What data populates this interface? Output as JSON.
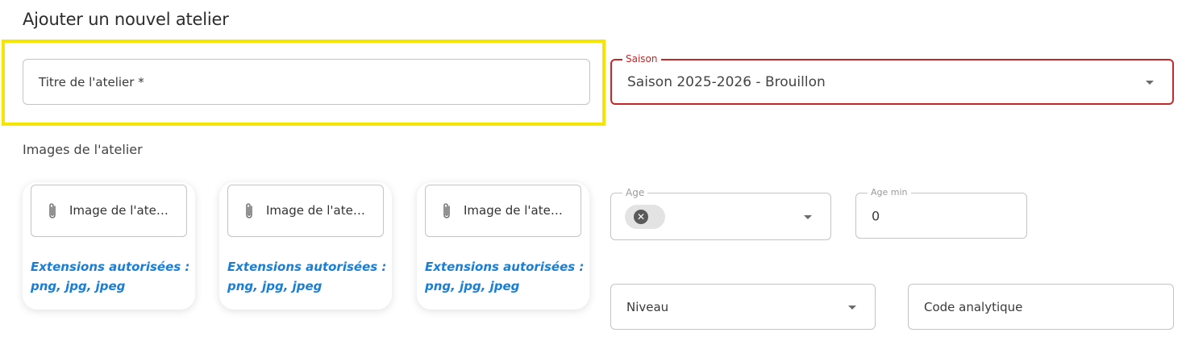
{
  "form": {
    "title": "Ajouter un nouvel atelier",
    "title_field": {
      "placeholder": "Titre de l'atelier *"
    },
    "season_field": {
      "label": "Saison",
      "value": "Saison 2025-2026 - Brouillon"
    },
    "images_section": {
      "label": "Images de l'atelier",
      "uploads": [
        {
          "label": "Image de l'atelier",
          "extensions_line1": "Extensions autorisées :",
          "extensions_line2": "png, jpg, jpeg"
        },
        {
          "label": "Image de l'atelier",
          "extensions_line1": "Extensions autorisées :",
          "extensions_line2": "png, jpg, jpeg"
        },
        {
          "label": "Image de l'atelier",
          "extensions_line1": "Extensions autorisées :",
          "extensions_line2": "png, jpg, jpeg"
        }
      ]
    },
    "age_field": {
      "label": "Age",
      "clear_icon": "close-icon"
    },
    "age_min_field": {
      "label": "Age min",
      "value": "0"
    },
    "level_field": {
      "placeholder": "Niveau"
    },
    "analytic_code_field": {
      "placeholder": "Code analytique"
    }
  },
  "colors": {
    "error": "#c62828",
    "highlight": "#f5e600",
    "extension_text": "#1a7fd4"
  }
}
